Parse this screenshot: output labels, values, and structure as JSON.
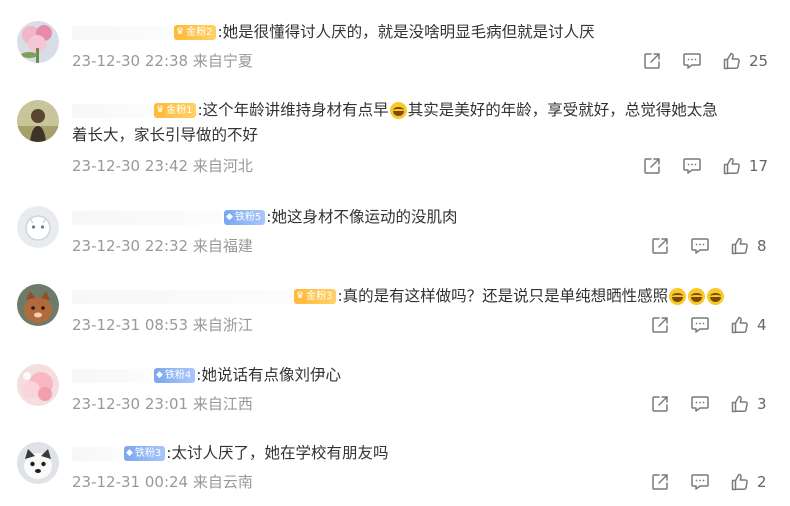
{
  "comments": [
    {
      "badge": "金粉2",
      "text": ":她是很懂得讨人厌的，就是没啥明显毛病但就是讨人厌",
      "date": "23-12-30 22:38",
      "location": "来自宁夏",
      "likes": "25"
    },
    {
      "badge": "金粉1",
      "text_a": ":这个年龄讲维持身材有点早",
      "text_b": "其实是美好的年龄，享受就好，总觉得她太急",
      "text_c": "着长大，家长引导做的不好",
      "date": "23-12-30 23:42",
      "location": "来自河北",
      "likes": "17"
    },
    {
      "badge": "铁粉5",
      "text": ":她这身材不像运动的没肌肉",
      "date": "23-12-30 22:32",
      "location": "来自福建",
      "likes": "8"
    },
    {
      "badge": "金粉3",
      "text": ":真的是有这样做吗？还是说只是单纯想晒性感照",
      "date": "23-12-31 08:53",
      "location": "来自浙江",
      "likes": "4"
    },
    {
      "badge": "铁粉4",
      "text": ":她说话有点像刘伊心",
      "date": "23-12-30 23:01",
      "location": "来自江西",
      "likes": "3"
    },
    {
      "badge": "铁粉3",
      "text": ":太讨人厌了，她在学校有朋友吗",
      "date": "23-12-31 00:24",
      "location": "来自云南",
      "likes": "2"
    }
  ]
}
